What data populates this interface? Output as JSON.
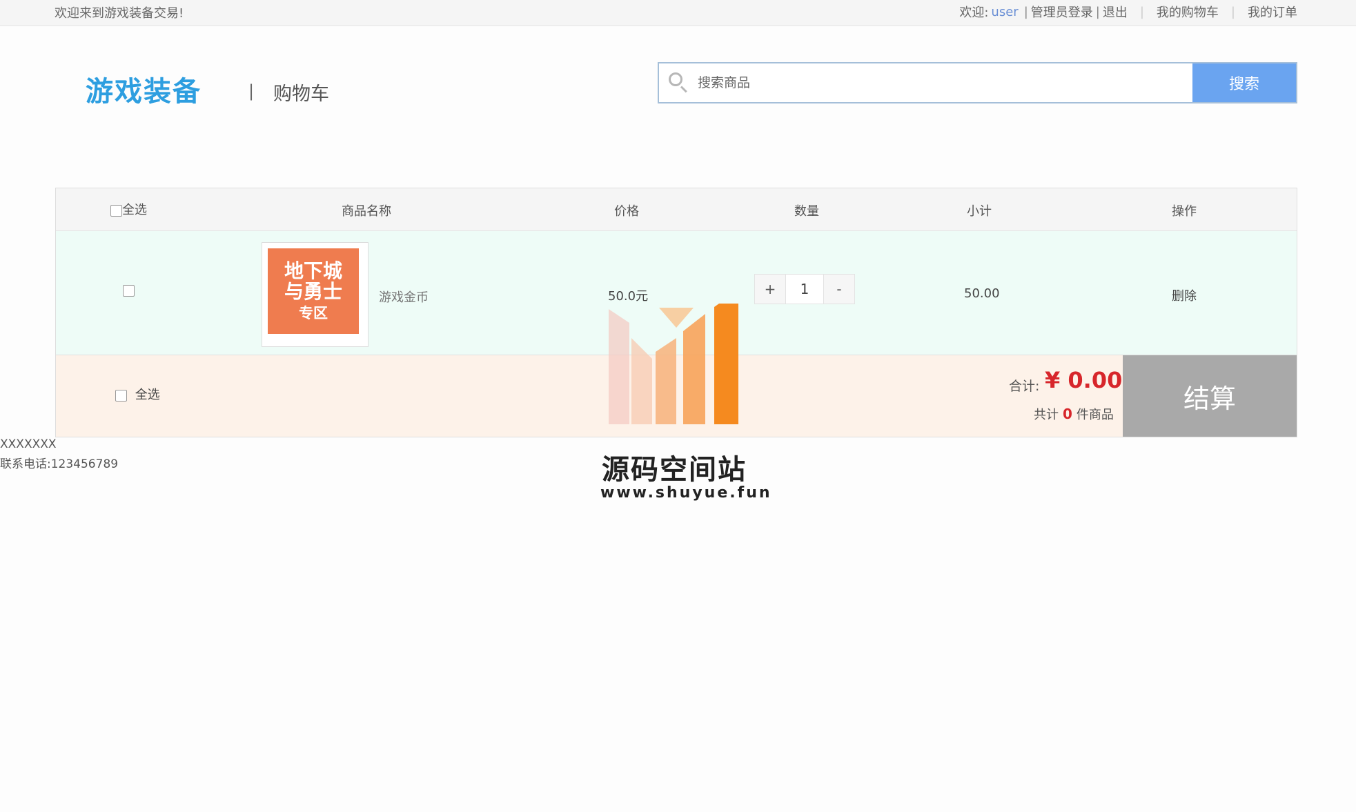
{
  "topbar": {
    "welcome": "欢迎来到游戏装备交易!",
    "greeting": "欢迎:",
    "username": "user",
    "admin_login": "管理员登录",
    "logout": "退出",
    "my_cart": "我的购物车",
    "my_orders": "我的订单"
  },
  "header": {
    "logo": "游戏装备",
    "divider": "|",
    "page_title": "购物车",
    "search_placeholder": "搜索商品",
    "search_button": "搜索"
  },
  "cart": {
    "columns": {
      "select_all": "全选",
      "name": "商品名称",
      "price": "价格",
      "quantity": "数量",
      "subtotal": "小计",
      "action": "操作"
    },
    "items": [
      {
        "thumb_line1": "地下城",
        "thumb_line2": "与勇士",
        "thumb_line3": "专区",
        "name": "游戏金币",
        "price": "50.0元",
        "quantity": "1",
        "plus": "+",
        "minus": "-",
        "subtotal": "50.00",
        "delete": "删除"
      }
    ],
    "footer": {
      "select_all": "全选",
      "total_label": "合计:",
      "total_value": "¥ 0.00",
      "count_prefix": "共计",
      "count_value": "0",
      "count_suffix": "件商品",
      "checkout": "结算"
    }
  },
  "footer": {
    "line1": "XXXXXXX",
    "line2": "联系电话:123456789"
  },
  "watermark": {
    "title": "源码空间站",
    "url": "www.shuyue.fun"
  },
  "colors": {
    "brand_blue": "#2d9ee0",
    "search_button": "#6aa4f0",
    "row_bg": "#eefcf7",
    "footer_bg": "#fdf2e9",
    "total_red": "#d7262b",
    "checkout_gray": "#a9a9a9"
  }
}
